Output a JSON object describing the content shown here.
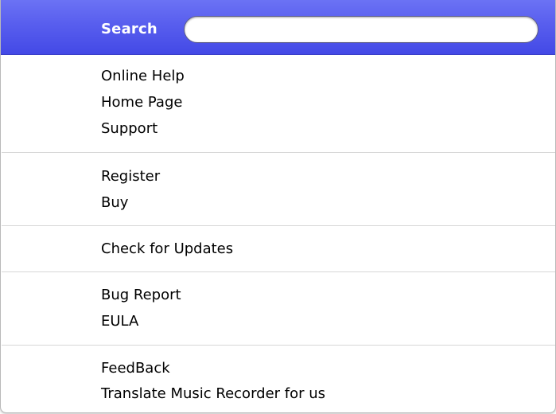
{
  "search": {
    "label": "Search",
    "value": "",
    "placeholder": ""
  },
  "menu": {
    "groups": [
      {
        "items": [
          {
            "label": "Online Help"
          },
          {
            "label": "Home Page"
          },
          {
            "label": "Support"
          }
        ]
      },
      {
        "items": [
          {
            "label": "Register"
          },
          {
            "label": "Buy"
          }
        ]
      },
      {
        "items": [
          {
            "label": "Check for Updates"
          }
        ]
      },
      {
        "items": [
          {
            "label": "Bug Report"
          },
          {
            "label": "EULA"
          }
        ]
      },
      {
        "items": [
          {
            "label": "FeedBack"
          },
          {
            "label": "Translate Music Recorder for us"
          }
        ]
      }
    ]
  },
  "colors": {
    "search_bar_top": "#6b72f4",
    "search_bar_bottom": "#4349e6",
    "divider": "#d6d6d6"
  }
}
